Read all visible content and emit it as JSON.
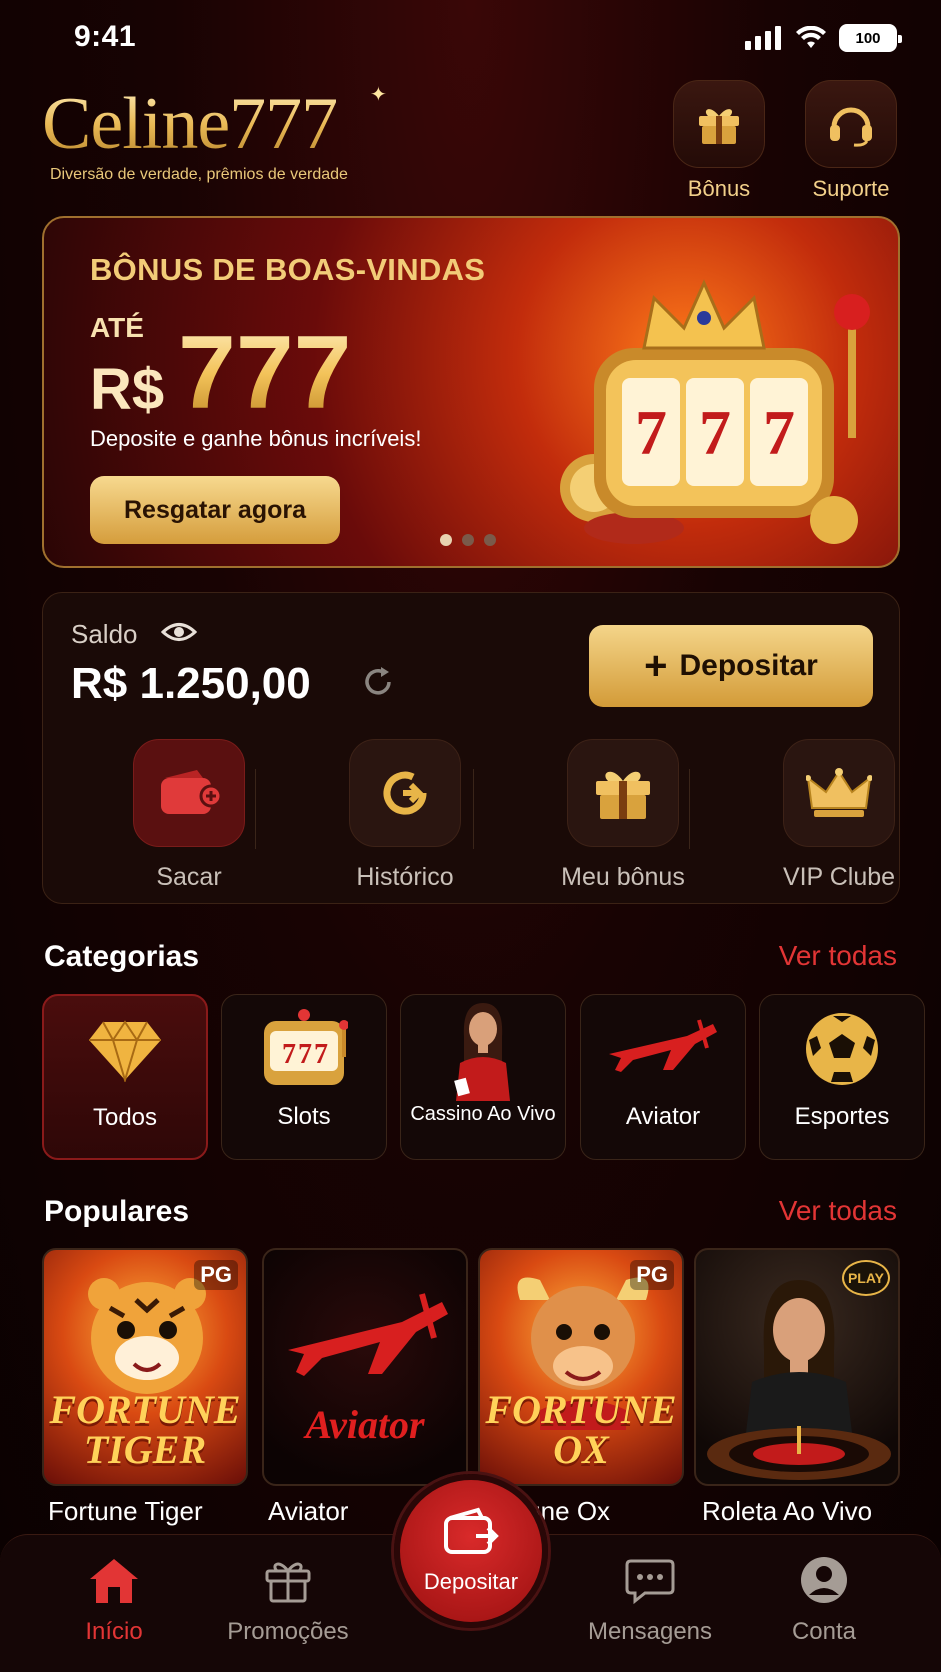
{
  "status": {
    "time": "9:41",
    "battery": "100"
  },
  "header": {
    "logo": "Celine777",
    "tagline": "Diversão de verdade, prêmios de verdade",
    "bonus_label": "Bônus",
    "support_label": "Suporte"
  },
  "banner": {
    "kicker": "BÔNUS DE BOAS-VINDAS",
    "up_to": "ATÉ",
    "currency": "R$",
    "amount": "777",
    "description": "Deposite e ganhe bônus incríveis!",
    "cta": "Resgatar agora",
    "slides_total": 3,
    "slide_active": 1
  },
  "balance": {
    "label": "Saldo",
    "amount": "R$ 1.250,00",
    "deposit_label": "Depositar",
    "actions": [
      {
        "label": "Sacar",
        "icon": "wallet-icon"
      },
      {
        "label": "Histórico",
        "icon": "history-icon"
      },
      {
        "label": "Meu bônus",
        "icon": "gift-icon"
      },
      {
        "label": "VIP Clube",
        "icon": "crown-icon"
      }
    ]
  },
  "categories": {
    "title": "Categorias",
    "see_all": "Ver todas",
    "items": [
      {
        "label": "Todos",
        "icon": "diamond-icon"
      },
      {
        "label": "Slots",
        "icon": "slot-machine-icon"
      },
      {
        "label": "Cassino Ao Vivo",
        "icon": "live-dealer-icon"
      },
      {
        "label": "Aviator",
        "icon": "plane-icon"
      },
      {
        "label": "Esportes",
        "icon": "soccer-ball-icon"
      }
    ]
  },
  "popular": {
    "title": "Populares",
    "see_all": "Ver todas",
    "games": [
      {
        "name": "Fortune Tiger",
        "badge": "PG",
        "art_title": "FORTUNE TIGER"
      },
      {
        "name": "Aviator",
        "badge": "",
        "art_title": "Aviator"
      },
      {
        "name": "Fortune Ox",
        "badge": "PG",
        "art_title": "FORTUNE OX"
      },
      {
        "name": "Roleta Ao Vivo",
        "badge": "PLAY",
        "art_title": ""
      }
    ]
  },
  "nav": {
    "home": "Início",
    "promotions": "Promoções",
    "deposit": "Depositar",
    "messages": "Mensagens",
    "account": "Conta"
  },
  "colors": {
    "accent_red": "#e23535",
    "gold": "#e9b955",
    "background": "#180303"
  }
}
